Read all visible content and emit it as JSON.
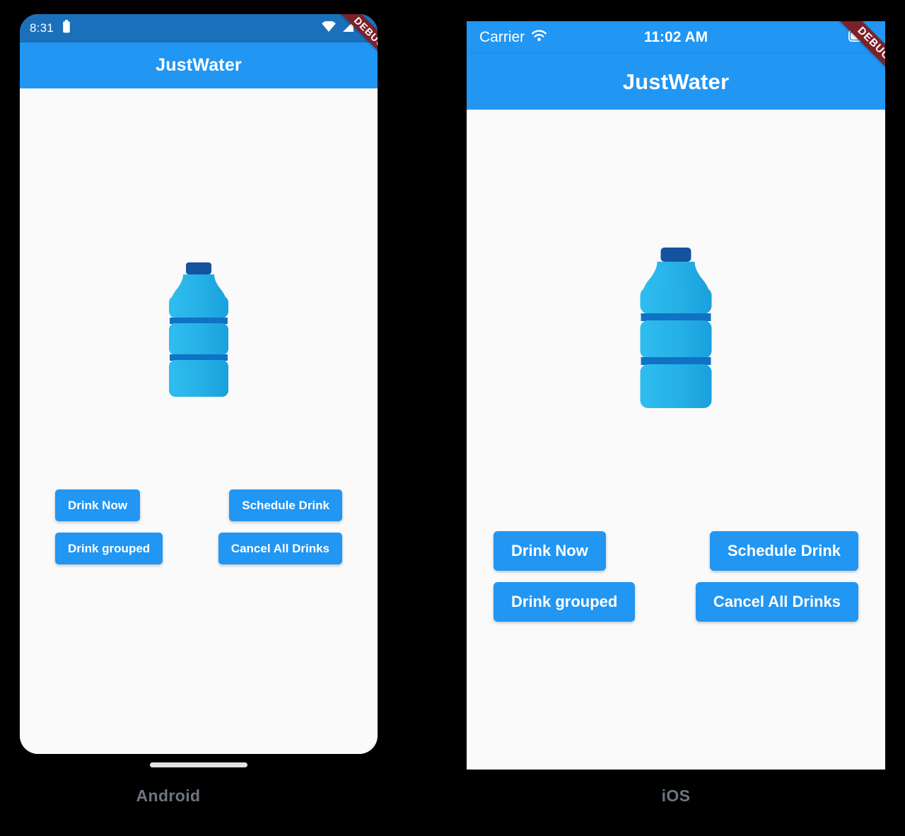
{
  "theme": {
    "primary": "#2196f3",
    "status_dark": "#1b70bc",
    "background": "#fafafa",
    "canvas": "#000000",
    "debug_banner": "#7a222a",
    "caption_text": "#6d7580",
    "button_text": "#ffffff",
    "bottle_light": "#29b6e8",
    "bottle_mid": "#1aa3dd",
    "bottle_band": "#0f72c4",
    "bottle_cap": "#15539e"
  },
  "android": {
    "caption": "Android",
    "status_bar": {
      "clock": "8:31",
      "left_icon": "battery-icon",
      "icons": [
        "wifi-icon",
        "cellular-signal-icon",
        "battery-icon"
      ]
    },
    "app_bar": {
      "title": "JustWater"
    },
    "debug_banner": "DEBUG",
    "bottle_icon": "water-bottle-icon",
    "buttons": [
      {
        "label": "Drink Now",
        "name": "drink-now-button"
      },
      {
        "label": "Schedule Drink",
        "name": "schedule-drink-button"
      },
      {
        "label": "Drink grouped",
        "name": "drink-grouped-button"
      },
      {
        "label": "Cancel All Drinks",
        "name": "cancel-all-drinks-button"
      }
    ],
    "home_indicator": "home-indicator"
  },
  "ios": {
    "caption": "iOS",
    "status_bar": {
      "carrier": "Carrier",
      "time": "11:02 AM",
      "icons": [
        "wifi-icon",
        "battery-icon"
      ]
    },
    "app_bar": {
      "title": "JustWater"
    },
    "debug_banner": "DEBUG",
    "bottle_icon": "water-bottle-icon",
    "buttons": [
      {
        "label": "Drink Now",
        "name": "drink-now-button"
      },
      {
        "label": "Schedule Drink",
        "name": "schedule-drink-button"
      },
      {
        "label": "Drink grouped",
        "name": "drink-grouped-button"
      },
      {
        "label": "Cancel All Drinks",
        "name": "cancel-all-drinks-button"
      }
    ]
  }
}
